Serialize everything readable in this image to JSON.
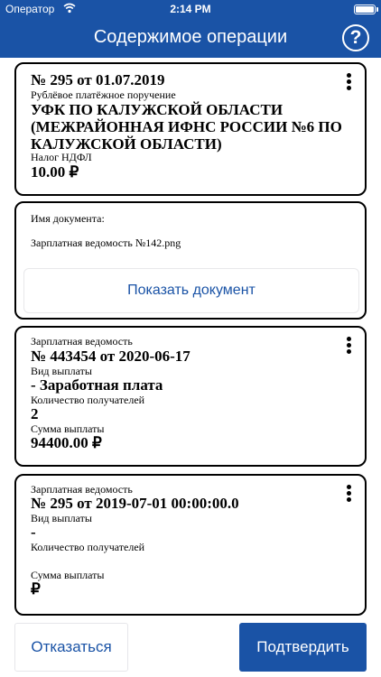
{
  "status_bar": {
    "carrier": "Оператор",
    "time": "2:14 PM"
  },
  "header": {
    "title": "Содержимое операции",
    "help_icon": "help-circle-icon"
  },
  "payment": {
    "number_line": "№ 295 от 01.07.2019",
    "type": "Рублёвое платёжное поручение",
    "recipient": "УФК ПО КАЛУЖСКОЙ ОБЛАСТИ (МЕЖРАЙОННАЯ ИФНС РОССИИ №6 ПО КАЛУЖСКОЙ ОБЛАСТИ)",
    "purpose": "Налог НДФЛ",
    "amount": "10.00 ₽"
  },
  "document": {
    "name_label": "Имя документа:",
    "file_name": "Зарплатная ведомость №142.png",
    "show_button": "Показать документ"
  },
  "payroll_1": {
    "label": "Зарплатная ведомость",
    "number_line": "№ 443454 от 2020-06-17",
    "payout_type_label": "Вид выплаты",
    "payout_type": "- Заработная плата",
    "recipients_label": "Количество получателей",
    "recipients": "2",
    "sum_label": "Сумма выплаты",
    "sum": "94400.00 ₽"
  },
  "payroll_2": {
    "label": "Зарплатная ведомость",
    "number_line": "№ 295 от 2019-07-01 00:00:00.0",
    "payout_type_label": "Вид выплаты",
    "payout_type": "-",
    "recipients_label": "Количество получателей",
    "recipients": "",
    "sum_label": "Сумма выплаты",
    "sum": "₽"
  },
  "actions": {
    "refuse": "Отказаться",
    "confirm": "Подтвердить"
  },
  "colors": {
    "brand": "#1a53a6",
    "background": "#ffffff"
  }
}
